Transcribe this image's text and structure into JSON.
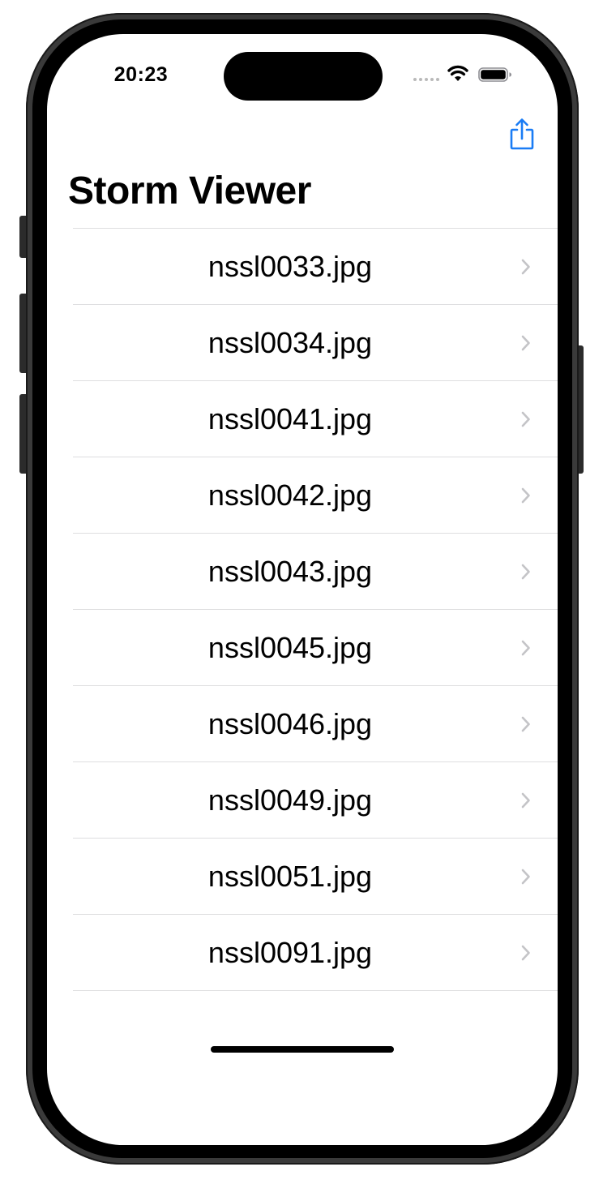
{
  "status_bar": {
    "time": "20:23"
  },
  "nav": {
    "title": "Storm Viewer",
    "share_icon": "share-icon",
    "accent_color": "#1a7cf5"
  },
  "table": {
    "rows": [
      {
        "label": "nssl0033.jpg"
      },
      {
        "label": "nssl0034.jpg"
      },
      {
        "label": "nssl0041.jpg"
      },
      {
        "label": "nssl0042.jpg"
      },
      {
        "label": "nssl0043.jpg"
      },
      {
        "label": "nssl0045.jpg"
      },
      {
        "label": "nssl0046.jpg"
      },
      {
        "label": "nssl0049.jpg"
      },
      {
        "label": "nssl0051.jpg"
      },
      {
        "label": "nssl0091.jpg"
      }
    ],
    "disclosure_icon": "chevron-right-icon"
  }
}
